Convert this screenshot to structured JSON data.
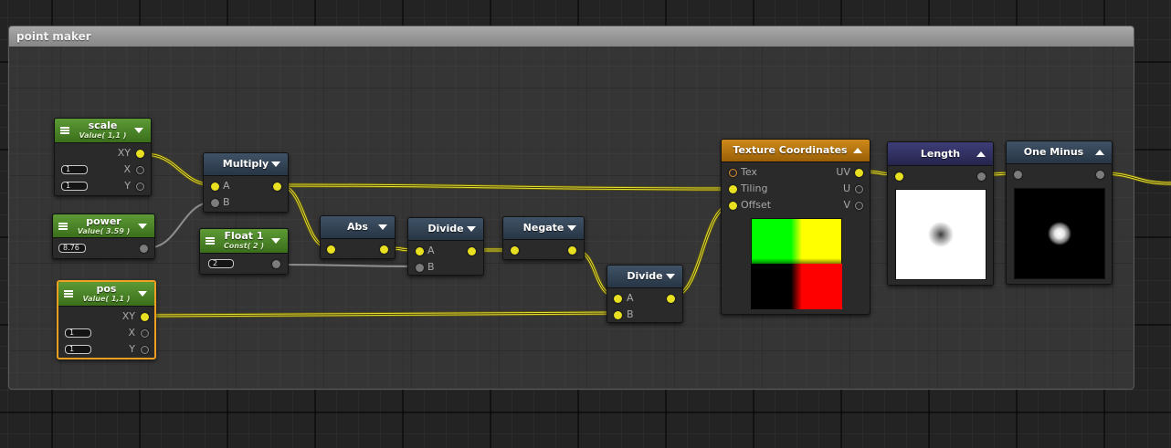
{
  "frame": {
    "title": "point maker"
  },
  "nodes": {
    "scale": {
      "title": "scale",
      "subtitle": "Value( 1,1 )",
      "out": "XY",
      "x_label": "X",
      "y_label": "Y",
      "x_value": "1",
      "y_value": "1"
    },
    "power": {
      "title": "power",
      "subtitle": "Value( 3.59 )",
      "value": "8.76"
    },
    "pos": {
      "title": "pos",
      "subtitle": "Value( 1,1 )",
      "out": "XY",
      "x_label": "X",
      "y_label": "Y",
      "x_value": "1",
      "y_value": "1"
    },
    "multiply": {
      "title": "Multiply",
      "in_a": "A",
      "in_b": "B"
    },
    "float1": {
      "title": "Float 1",
      "subtitle": "Const( 2 )",
      "value": "2"
    },
    "abs": {
      "title": "Abs"
    },
    "divide1": {
      "title": "Divide",
      "in_a": "A",
      "in_b": "B"
    },
    "negate": {
      "title": "Negate"
    },
    "divide2": {
      "title": "Divide",
      "in_a": "A",
      "in_b": "B"
    },
    "texcoord": {
      "title": "Texture Coordinates",
      "in_tex": "Tex",
      "in_tiling": "Tiling",
      "in_offset": "Offset",
      "out_uv": "UV",
      "out_u": "U",
      "out_v": "V"
    },
    "length": {
      "title": "Length"
    },
    "oneminus": {
      "title": "One Minus"
    }
  },
  "colors": {
    "wire": "#e8e030",
    "wire_inactive": "#8e8e8e",
    "pin_active": "#e8e020",
    "header_green": "#4a8228",
    "header_blue": "#324355",
    "header_orange": "#b8760e",
    "header_purple": "#323163",
    "selected_border": "#f0a020"
  },
  "icons": {
    "menu": "hamburger-menu-icon",
    "collapse": "triangle-down-icon",
    "expand": "triangle-up-icon"
  }
}
